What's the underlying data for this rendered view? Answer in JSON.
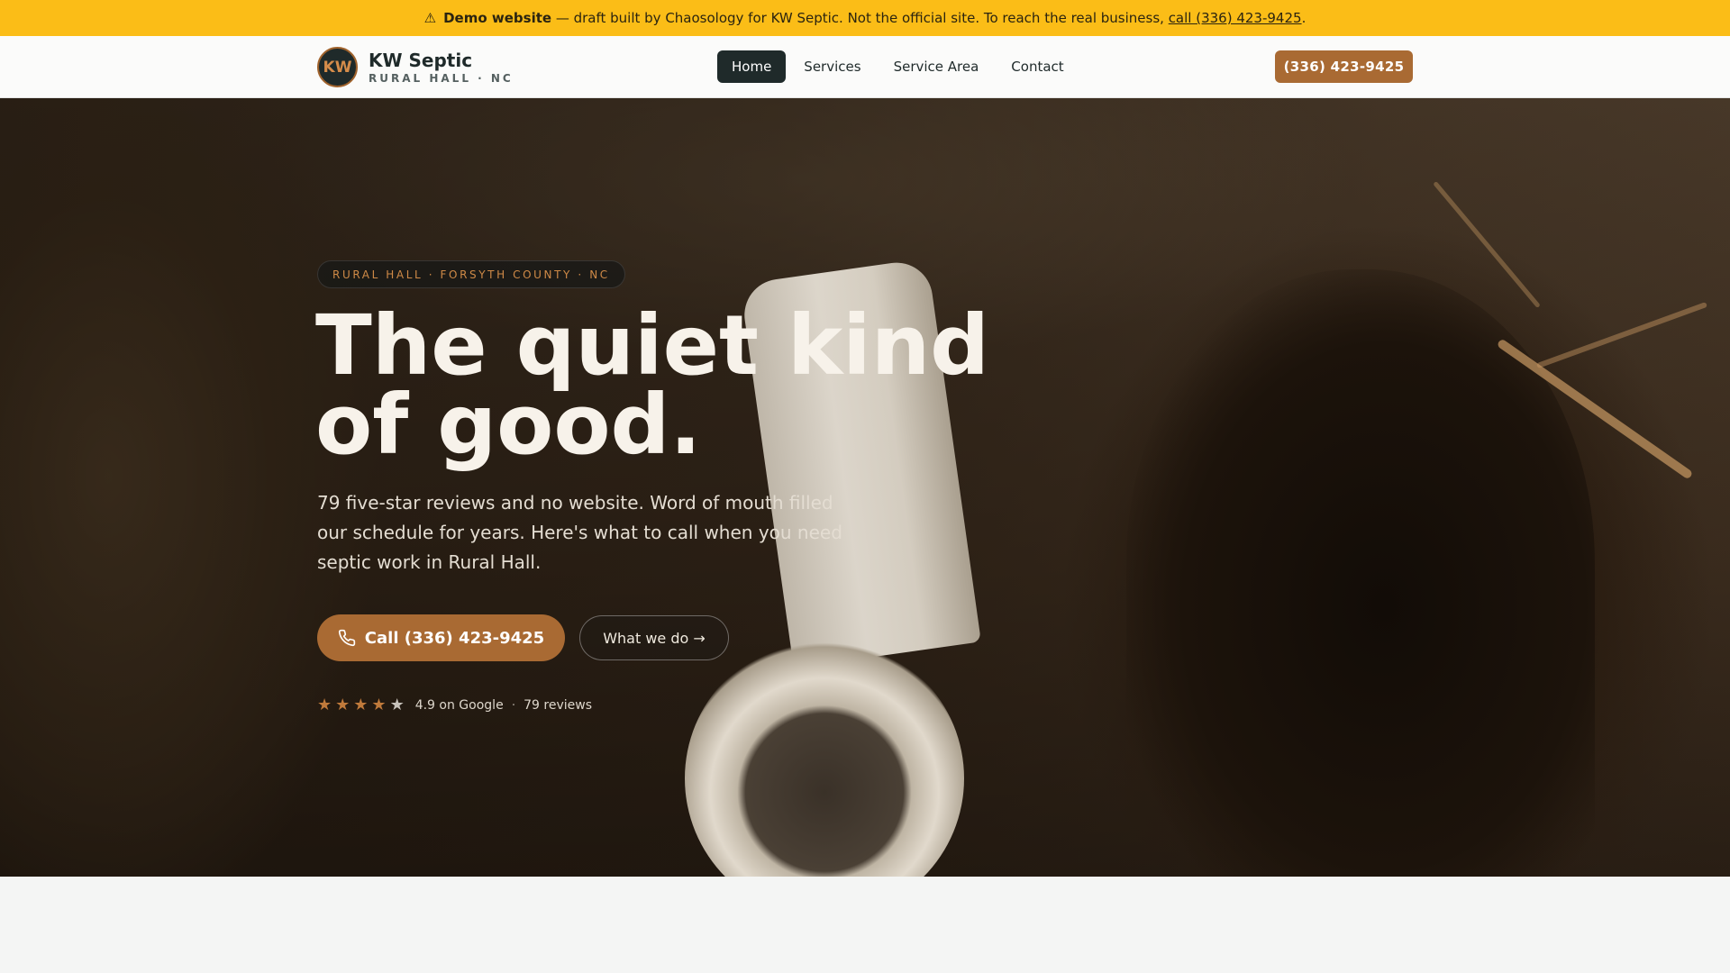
{
  "banner": {
    "icon": "warning-icon",
    "bold": "Demo website",
    "text": " — draft built by Chaosology for KW Septic. Not the official site. To reach the real business, ",
    "link": "call (336) 423-9425",
    "end": "."
  },
  "header": {
    "logo_initials": "KW",
    "brand_name": "KW Septic",
    "brand_sub": "RURAL HALL · NC",
    "nav": [
      "Home",
      "Services",
      "Service Area",
      "Contact"
    ],
    "active_nav": "Home",
    "cta": "(336) 423-9425"
  },
  "hero": {
    "tag": "RURAL HALL · FORSYTH COUNTY · NC",
    "headline_line1": "The quiet kind",
    "headline_line2": "of good.",
    "subtext": "79 five-star reviews and no website. Word of mouth filled our schedule for years. Here's what to call when you need septic work in Rural Hall.",
    "call_button": "Call (336) 423-9425",
    "call_icon": "phone-icon",
    "secondary_button": "What we do →",
    "rating": {
      "stars_filled": 4,
      "stars_total": 5,
      "score_text": "4.9 on Google",
      "reviews_text": "79 reviews"
    }
  },
  "colors": {
    "banner": "#fbbd17",
    "accent": "#a96a33",
    "dark": "#1f2a2a",
    "tag_text": "#cf8a47"
  }
}
